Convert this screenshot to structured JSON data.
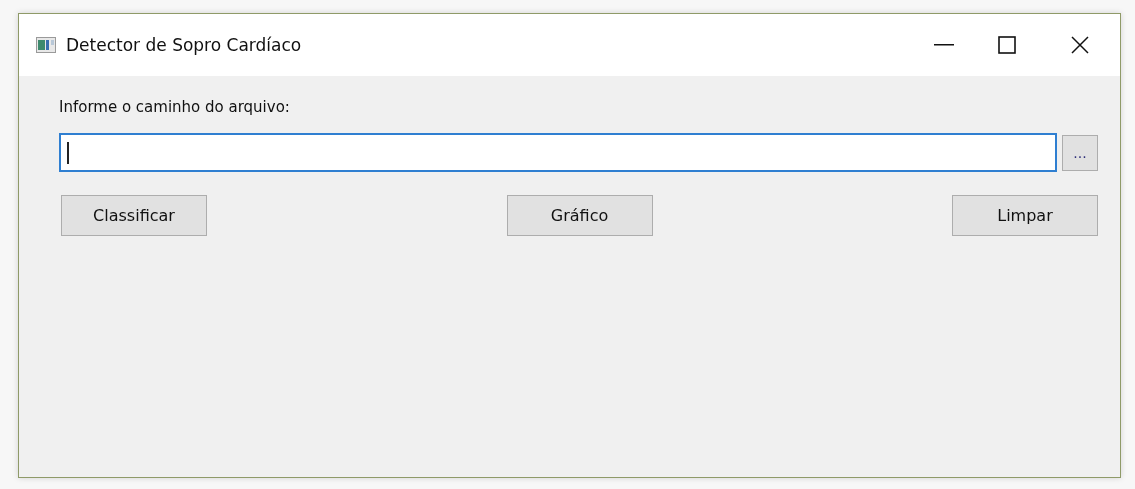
{
  "window": {
    "title": "Detector de Sopro Cardíaco"
  },
  "file_path": {
    "label": "Informe o caminho do arquivo:",
    "focused": true,
    "browse_button": "..."
  },
  "buttons": [
    "Classificar",
    "Gráfico",
    "Limpar"
  ]
}
